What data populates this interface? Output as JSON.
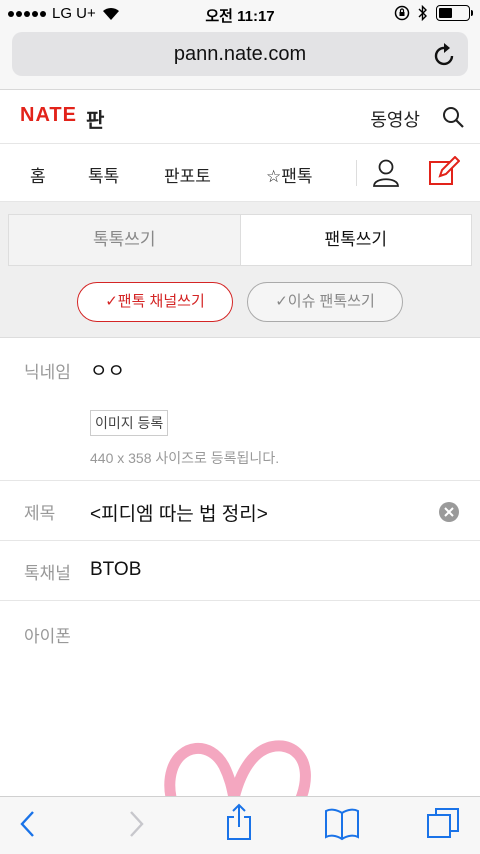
{
  "status": {
    "carrier": "LG U+",
    "time": "오전 11:17",
    "battery_level": 0.45
  },
  "browser": {
    "url": "pann.nate.com"
  },
  "header": {
    "logo": "NATE",
    "logo_sub": "판",
    "video_link": "동영상"
  },
  "nav": {
    "items": [
      "홈",
      "톡톡",
      "판포토",
      "☆팬톡"
    ]
  },
  "tabs": {
    "left": "톡톡쓰기",
    "right": "팬톡쓰기"
  },
  "pills": {
    "selected": "✓팬톡 채널쓰기",
    "unselected": "✓이슈 팬톡쓰기"
  },
  "form": {
    "nickname_label": "닉네임",
    "nickname_value": "ㅇㅇ",
    "image_button": "이미지 등록",
    "image_hint": "440 x 358 사이즈로 등록됩니다.",
    "title_label": "제목",
    "title_value": "<피디엠 따는 법 정리>",
    "channel_label": "톡채널",
    "channel_value": "BTOB",
    "body_placeholder": "아이폰"
  },
  "colors": {
    "brand_red": "#e2231a",
    "heart_pink": "#f4a7c0"
  }
}
